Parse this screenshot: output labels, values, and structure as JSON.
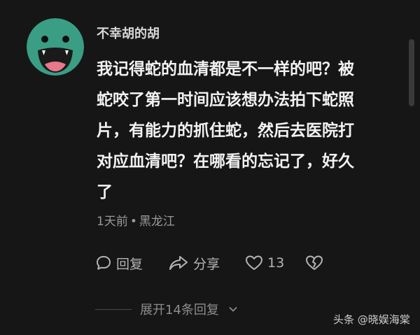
{
  "comment": {
    "username": "不幸胡的胡",
    "avatar_icon": "green-monster-avatar",
    "body_lines": [
      "我记得蛇的血清都是不一样的吧？被",
      "蛇咬了第一时间应该想办法拍下蛇照",
      "片，有能力的抓住蛇，然后去医院打",
      "对应血清吧？在哪看的忘记了，好久",
      "了"
    ],
    "time": "1天前",
    "separator": "•",
    "location": "黑龙江"
  },
  "actions": {
    "reply_icon": "speech-bubble-icon",
    "reply_label": "回复",
    "share_icon": "share-arrow-icon",
    "share_label": "分享",
    "like_icon": "heart-outline-icon",
    "like_count": "13",
    "dislike_icon": "broken-heart-icon"
  },
  "expand_replies": {
    "label": "展开14条回复",
    "icon": "chevron-down-icon"
  },
  "watermark": {
    "text": "头条 @晓娱海棠"
  },
  "colors": {
    "background": "#161616",
    "avatar_green": "#3a9e84",
    "text_primary": "#f2f2f2",
    "text_secondary": "#9a9a9a"
  }
}
